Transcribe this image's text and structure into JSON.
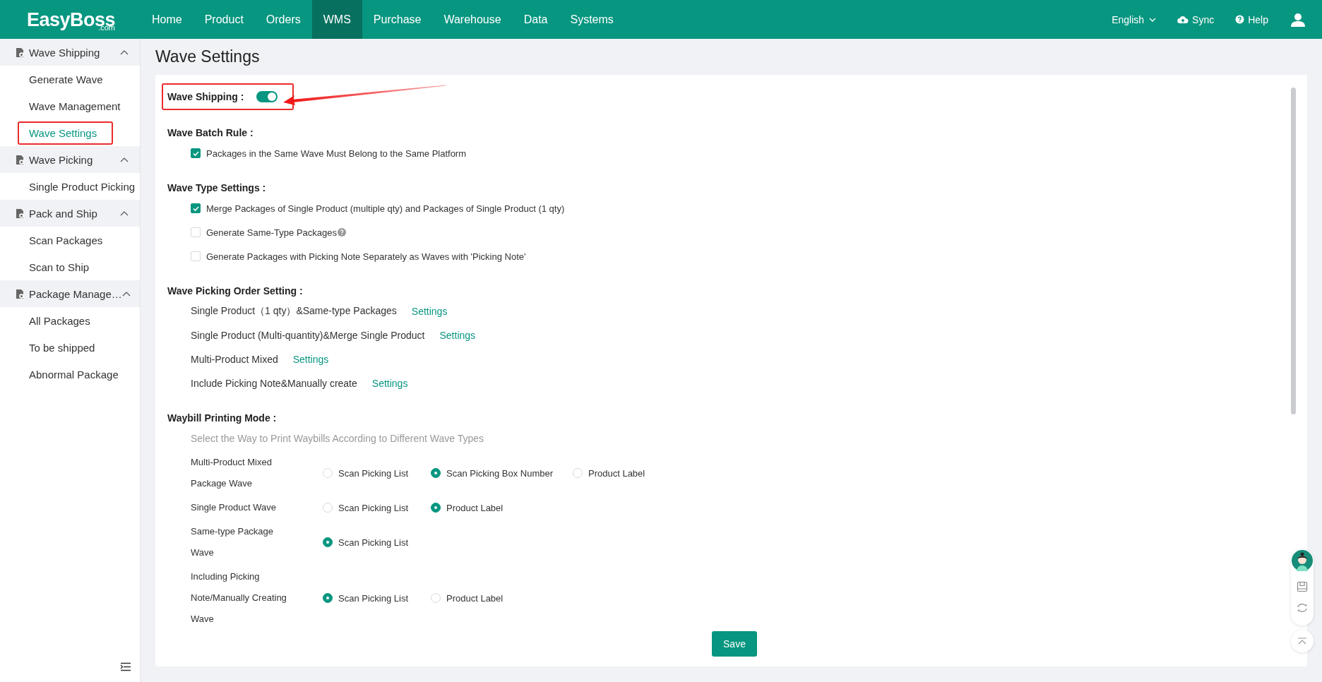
{
  "brand": {
    "name": "EasyBoss",
    "suffix": ".com"
  },
  "nav": [
    {
      "label": "Home",
      "selected": false
    },
    {
      "label": "Product",
      "selected": false
    },
    {
      "label": "Orders",
      "selected": false
    },
    {
      "label": "WMS",
      "selected": true
    },
    {
      "label": "Purchase",
      "selected": false
    },
    {
      "label": "Warehouse",
      "selected": false
    },
    {
      "label": "Data",
      "selected": false
    },
    {
      "label": "Systems",
      "selected": false
    }
  ],
  "header_actions": [
    {
      "kind": "language",
      "label": "English"
    },
    {
      "kind": "sync",
      "label": "Sync"
    },
    {
      "kind": "help",
      "label": "Help"
    },
    {
      "kind": "user"
    }
  ],
  "sidebar": {
    "groups": [
      {
        "label": "Wave Shipping",
        "expanded": true,
        "items": [
          {
            "label": "Generate Wave",
            "selected": false,
            "highlighted": false
          },
          {
            "label": "Wave Management",
            "selected": false,
            "highlighted": false
          },
          {
            "label": "Wave Settings",
            "selected": true,
            "highlighted": true
          }
        ]
      },
      {
        "label": "Wave Picking",
        "expanded": true,
        "items": [
          {
            "label": "Single Product Picking",
            "selected": false,
            "highlighted": false
          }
        ]
      },
      {
        "label": "Pack and Ship",
        "expanded": true,
        "items": [
          {
            "label": "Scan Packages",
            "selected": false,
            "highlighted": false
          },
          {
            "label": "Scan to Ship",
            "selected": false,
            "highlighted": false
          }
        ]
      },
      {
        "label": "Package Manage…",
        "expanded": true,
        "items": [
          {
            "label": "All Packages",
            "selected": false,
            "highlighted": false
          },
          {
            "label": "To be shipped",
            "selected": false,
            "highlighted": false
          },
          {
            "label": "Abnormal Package",
            "selected": false,
            "highlighted": false
          }
        ]
      }
    ]
  },
  "page_title": "Wave Settings",
  "wave_shipping": {
    "label": "Wave Shipping :",
    "on": true,
    "highlighted": true
  },
  "sections": [
    {
      "kind": "checkboxes",
      "title": "Wave Batch Rule :",
      "items": [
        {
          "label": "Packages in the Same Wave Must Belong to the Same Platform",
          "checked": true,
          "help": false
        }
      ]
    },
    {
      "kind": "checkboxes",
      "title": "Wave Type Settings :",
      "items": [
        {
          "label": "Merge Packages of Single Product (multiple qty) and Packages of Single Product (1 qty)",
          "checked": true,
          "help": false
        },
        {
          "label": "Generate Same-Type Packages",
          "checked": false,
          "help": true
        },
        {
          "label": "Generate Packages with Picking Note Separately as Waves with 'Picking Note'",
          "checked": false,
          "help": false
        }
      ]
    },
    {
      "kind": "links",
      "title": "Wave Picking Order Setting :",
      "rows": [
        {
          "label": "Single Product（1 qty）&Same-type Packages",
          "link": "Settings"
        },
        {
          "label": "Single Product (Multi-quantity)&Merge Single Product",
          "link": "Settings"
        },
        {
          "label": "Multi-Product Mixed",
          "link": "Settings"
        },
        {
          "label": "Include Picking Note&Manually create",
          "link": "Settings"
        }
      ]
    },
    {
      "kind": "radios",
      "title": "Waybill Printing Mode :",
      "hint": "Select the Way to Print Waybills According to Different Wave Types",
      "rows": [
        {
          "label": "Multi-Product Mixed Package Wave",
          "options": [
            {
              "label": "Scan Picking List",
              "selected": false
            },
            {
              "label": "Scan Picking Box Number",
              "selected": true
            },
            {
              "label": "Product Label",
              "selected": false
            }
          ]
        },
        {
          "label": "Single Product Wave",
          "options": [
            {
              "label": "Scan Picking List",
              "selected": false
            },
            {
              "label": "Product Label",
              "selected": true
            }
          ]
        },
        {
          "label": "Same-type Package Wave",
          "options": [
            {
              "label": "Scan Picking List",
              "selected": true
            }
          ]
        },
        {
          "label": "Including Picking Note/Manually Creating Wave",
          "options": [
            {
              "label": "Scan Picking List",
              "selected": true
            },
            {
              "label": "Product Label",
              "selected": false
            }
          ]
        }
      ]
    }
  ],
  "save_button": "Save"
}
